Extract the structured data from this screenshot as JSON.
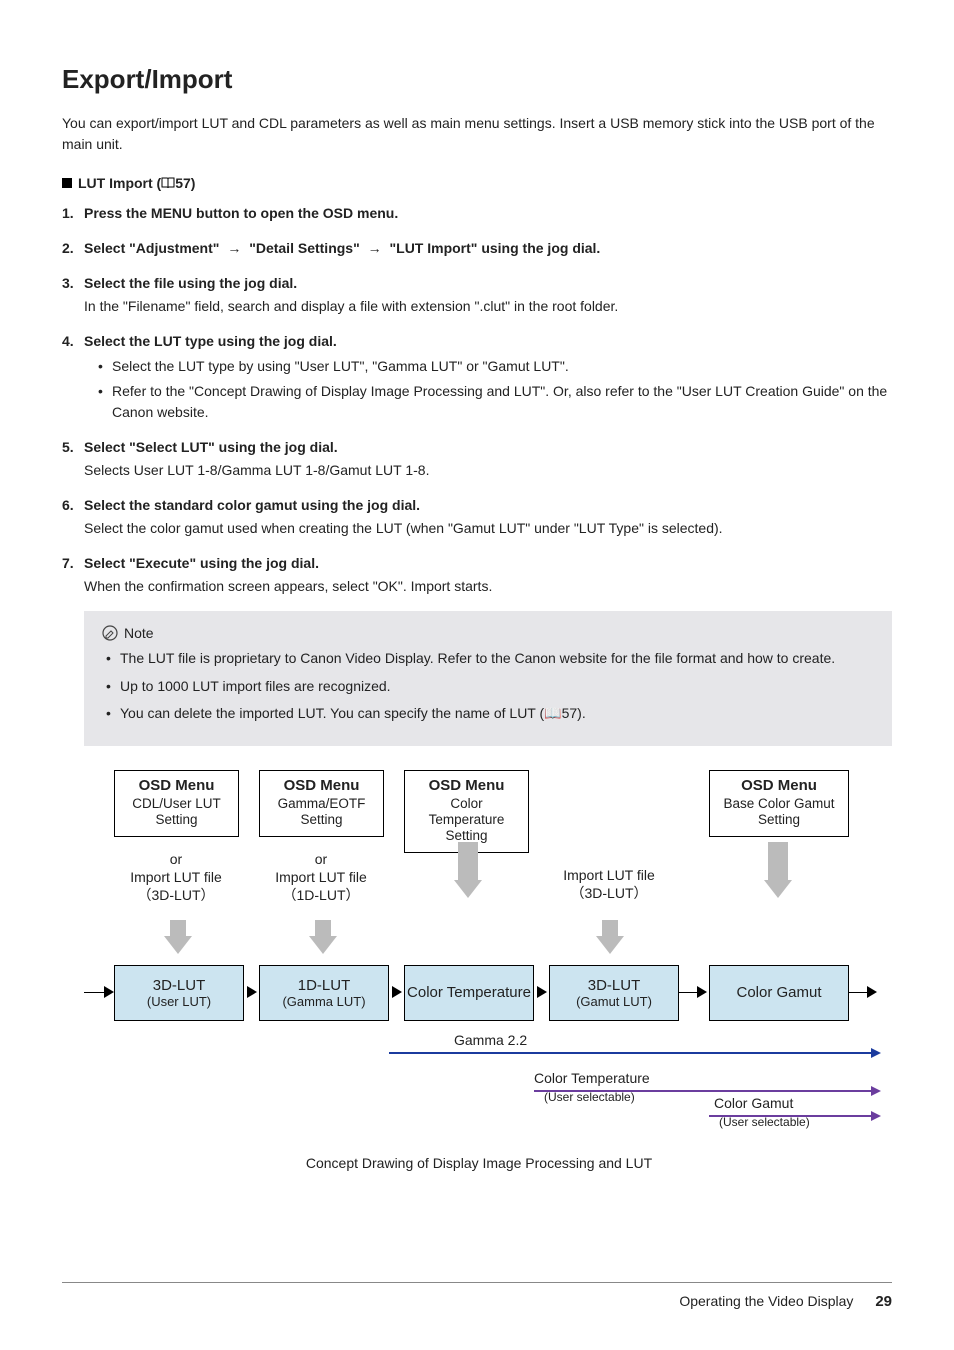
{
  "title": "Export/Import",
  "intro": "You can export/import LUT and CDL parameters as well as main menu settings. Insert a USB memory stick into the USB port of the main unit.",
  "section_heading_pre": "LUT Import (",
  "section_heading_ref": "57)",
  "steps": [
    {
      "num": "1.",
      "title": "Press the MENU button to open the OSD menu.",
      "body": ""
    },
    {
      "num": "2.",
      "title_parts": [
        "Select \"Adjustment\" ",
        "→",
        " \"Detail Settings\" ",
        "→",
        " \"LUT Import\" using the jog dial."
      ],
      "body": ""
    },
    {
      "num": "3.",
      "title": "Select the file using the jog dial.",
      "body": "In the \"Filename\" field, search and display a file with extension \".clut\" in the root folder."
    },
    {
      "num": "4.",
      "title": "Select the LUT type using the jog dial.",
      "bullets": [
        "Select the LUT type by using \"User LUT\", \"Gamma LUT\" or \"Gamut LUT\".",
        "Refer to the \"Concept Drawing of Display Image Processing and LUT\". Or, also refer to the \"User LUT Creation Guide\" on the Canon website."
      ]
    },
    {
      "num": "5.",
      "title": "Select \"Select LUT\" using the jog dial.",
      "body": "Selects User LUT 1-8/Gamma LUT 1-8/Gamut LUT 1-8."
    },
    {
      "num": "6.",
      "title": "Select the standard color gamut using the jog dial.",
      "body": "Select the color gamut used when creating the LUT (when \"Gamut LUT\" under \"LUT Type\" is selected)."
    },
    {
      "num": "7.",
      "title": "Select \"Execute\" using the jog dial.",
      "body": "When the confirmation screen appears, select \"OK\". Import starts."
    }
  ],
  "note": {
    "label": "Note",
    "bullets": [
      "The LUT file is proprietary to Canon Video Display. Refer to the Canon website for the file format and how to create.",
      "Up to 1000 LUT import files are recognized.",
      "You can delete the imported LUT. You can specify the name of LUT (📖57)."
    ]
  },
  "diagram": {
    "osd": [
      {
        "title": "OSD Menu",
        "sub": "CDL/User LUT Setting"
      },
      {
        "title": "OSD Menu",
        "sub": "Gamma/EOTF Setting"
      },
      {
        "title": "OSD Menu",
        "sub": "Color Temperature Setting"
      },
      {
        "title": "OSD Menu",
        "sub": "Base Color Gamut Setting"
      }
    ],
    "mid": [
      "or\nImport LUT file\n（3D-LUT）",
      "or\nImport LUT file\n（1D-LUT）",
      "Import LUT file\n（3D-LUT）"
    ],
    "lut": [
      {
        "t": "3D-LUT",
        "s": "(User LUT)"
      },
      {
        "t": "1D-LUT",
        "s": "(Gamma LUT)"
      },
      {
        "t": "Color Temperature",
        "s": ""
      },
      {
        "t": "3D-LUT",
        "s": "(Gamut LUT)"
      },
      {
        "t": "Color Gamut",
        "s": ""
      }
    ],
    "gamma_label": "Gamma 2.2",
    "ct_label": "Color Temperature",
    "ct_sub": "(User selectable)",
    "cg_label": "Color Gamut",
    "cg_sub": "(User selectable)",
    "caption": "Concept Drawing of Display Image Processing and LUT"
  },
  "footer": {
    "text": "Operating the Video Display",
    "page": "29"
  }
}
